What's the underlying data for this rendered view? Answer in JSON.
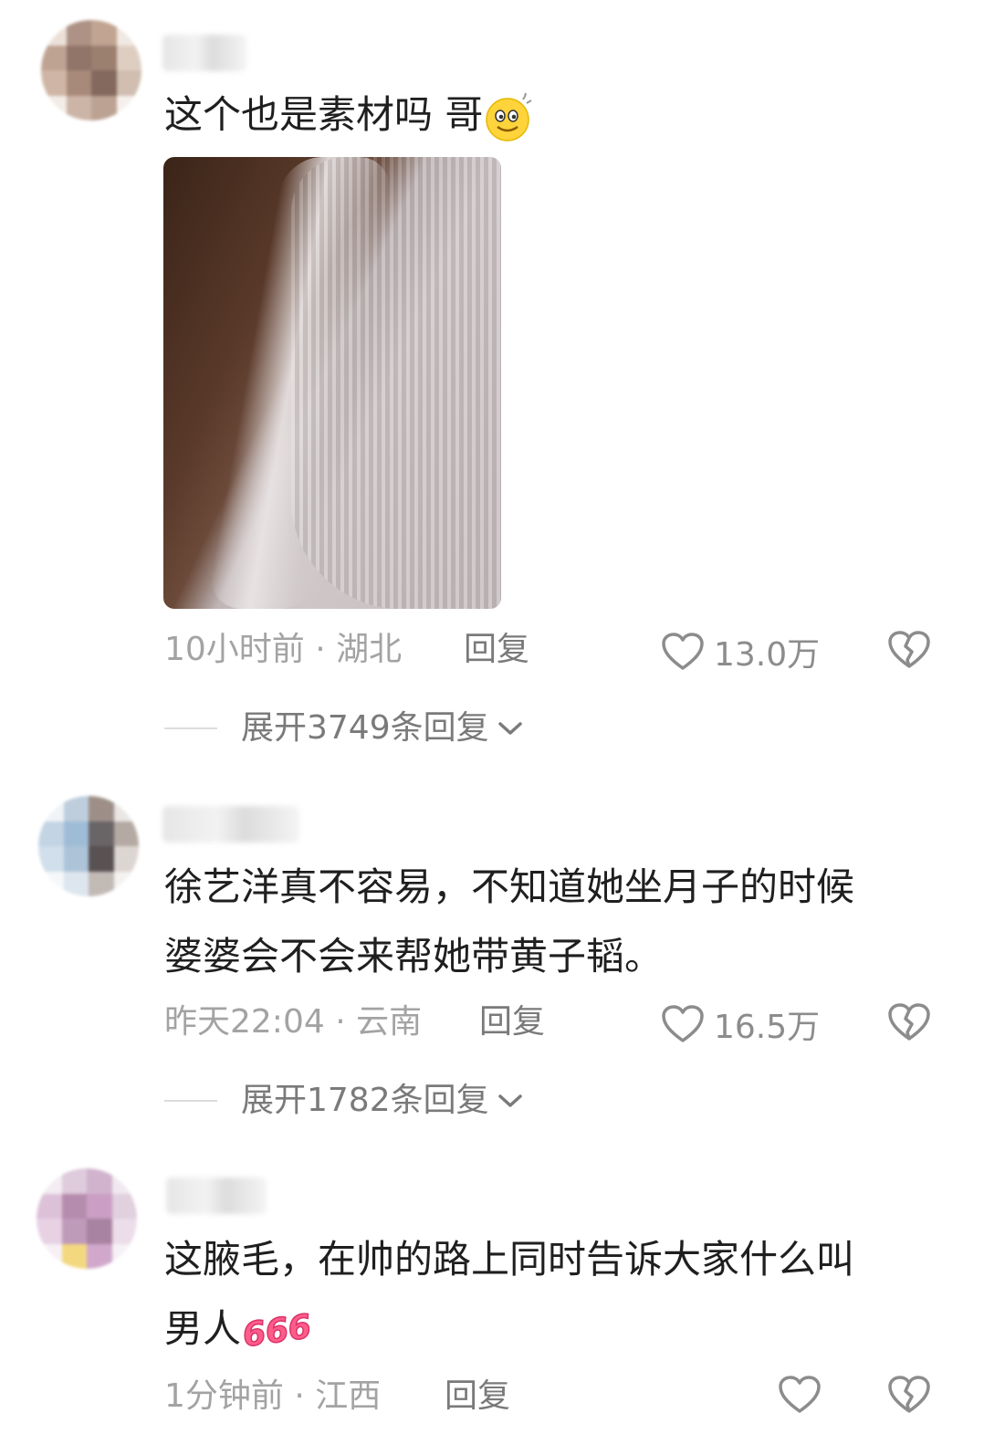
{
  "comments": [
    {
      "text_line1": "这个也是素材吗 哥",
      "text_line2": "",
      "meta": "10小时前 · 湖北",
      "reply_label": "回复",
      "likes": "13.0万",
      "expand_label": "展开3749条回复",
      "has_image": true,
      "emoji": "smile-emoji"
    },
    {
      "text_line1": "徐艺洋真不容易，不知道她坐月子的时候",
      "text_line2": "婆婆会不会来帮她带黄子韬。",
      "meta": "昨天22:04 · 云南",
      "reply_label": "回复",
      "likes": "16.5万",
      "expand_label": "展开1782条回复"
    },
    {
      "text_line1": "这腋毛，在帅的路上同时告诉大家什么叫",
      "text_line2": "男人",
      "meta": "1分钟前 · 江西",
      "reply_label": "回复",
      "emoji_text": "666"
    }
  ],
  "colors": {
    "text": "#1f1f1f",
    "meta": "#a3a3a3",
    "icon": "#8c8c8c",
    "sticker_pink": "#ff5c8a"
  }
}
